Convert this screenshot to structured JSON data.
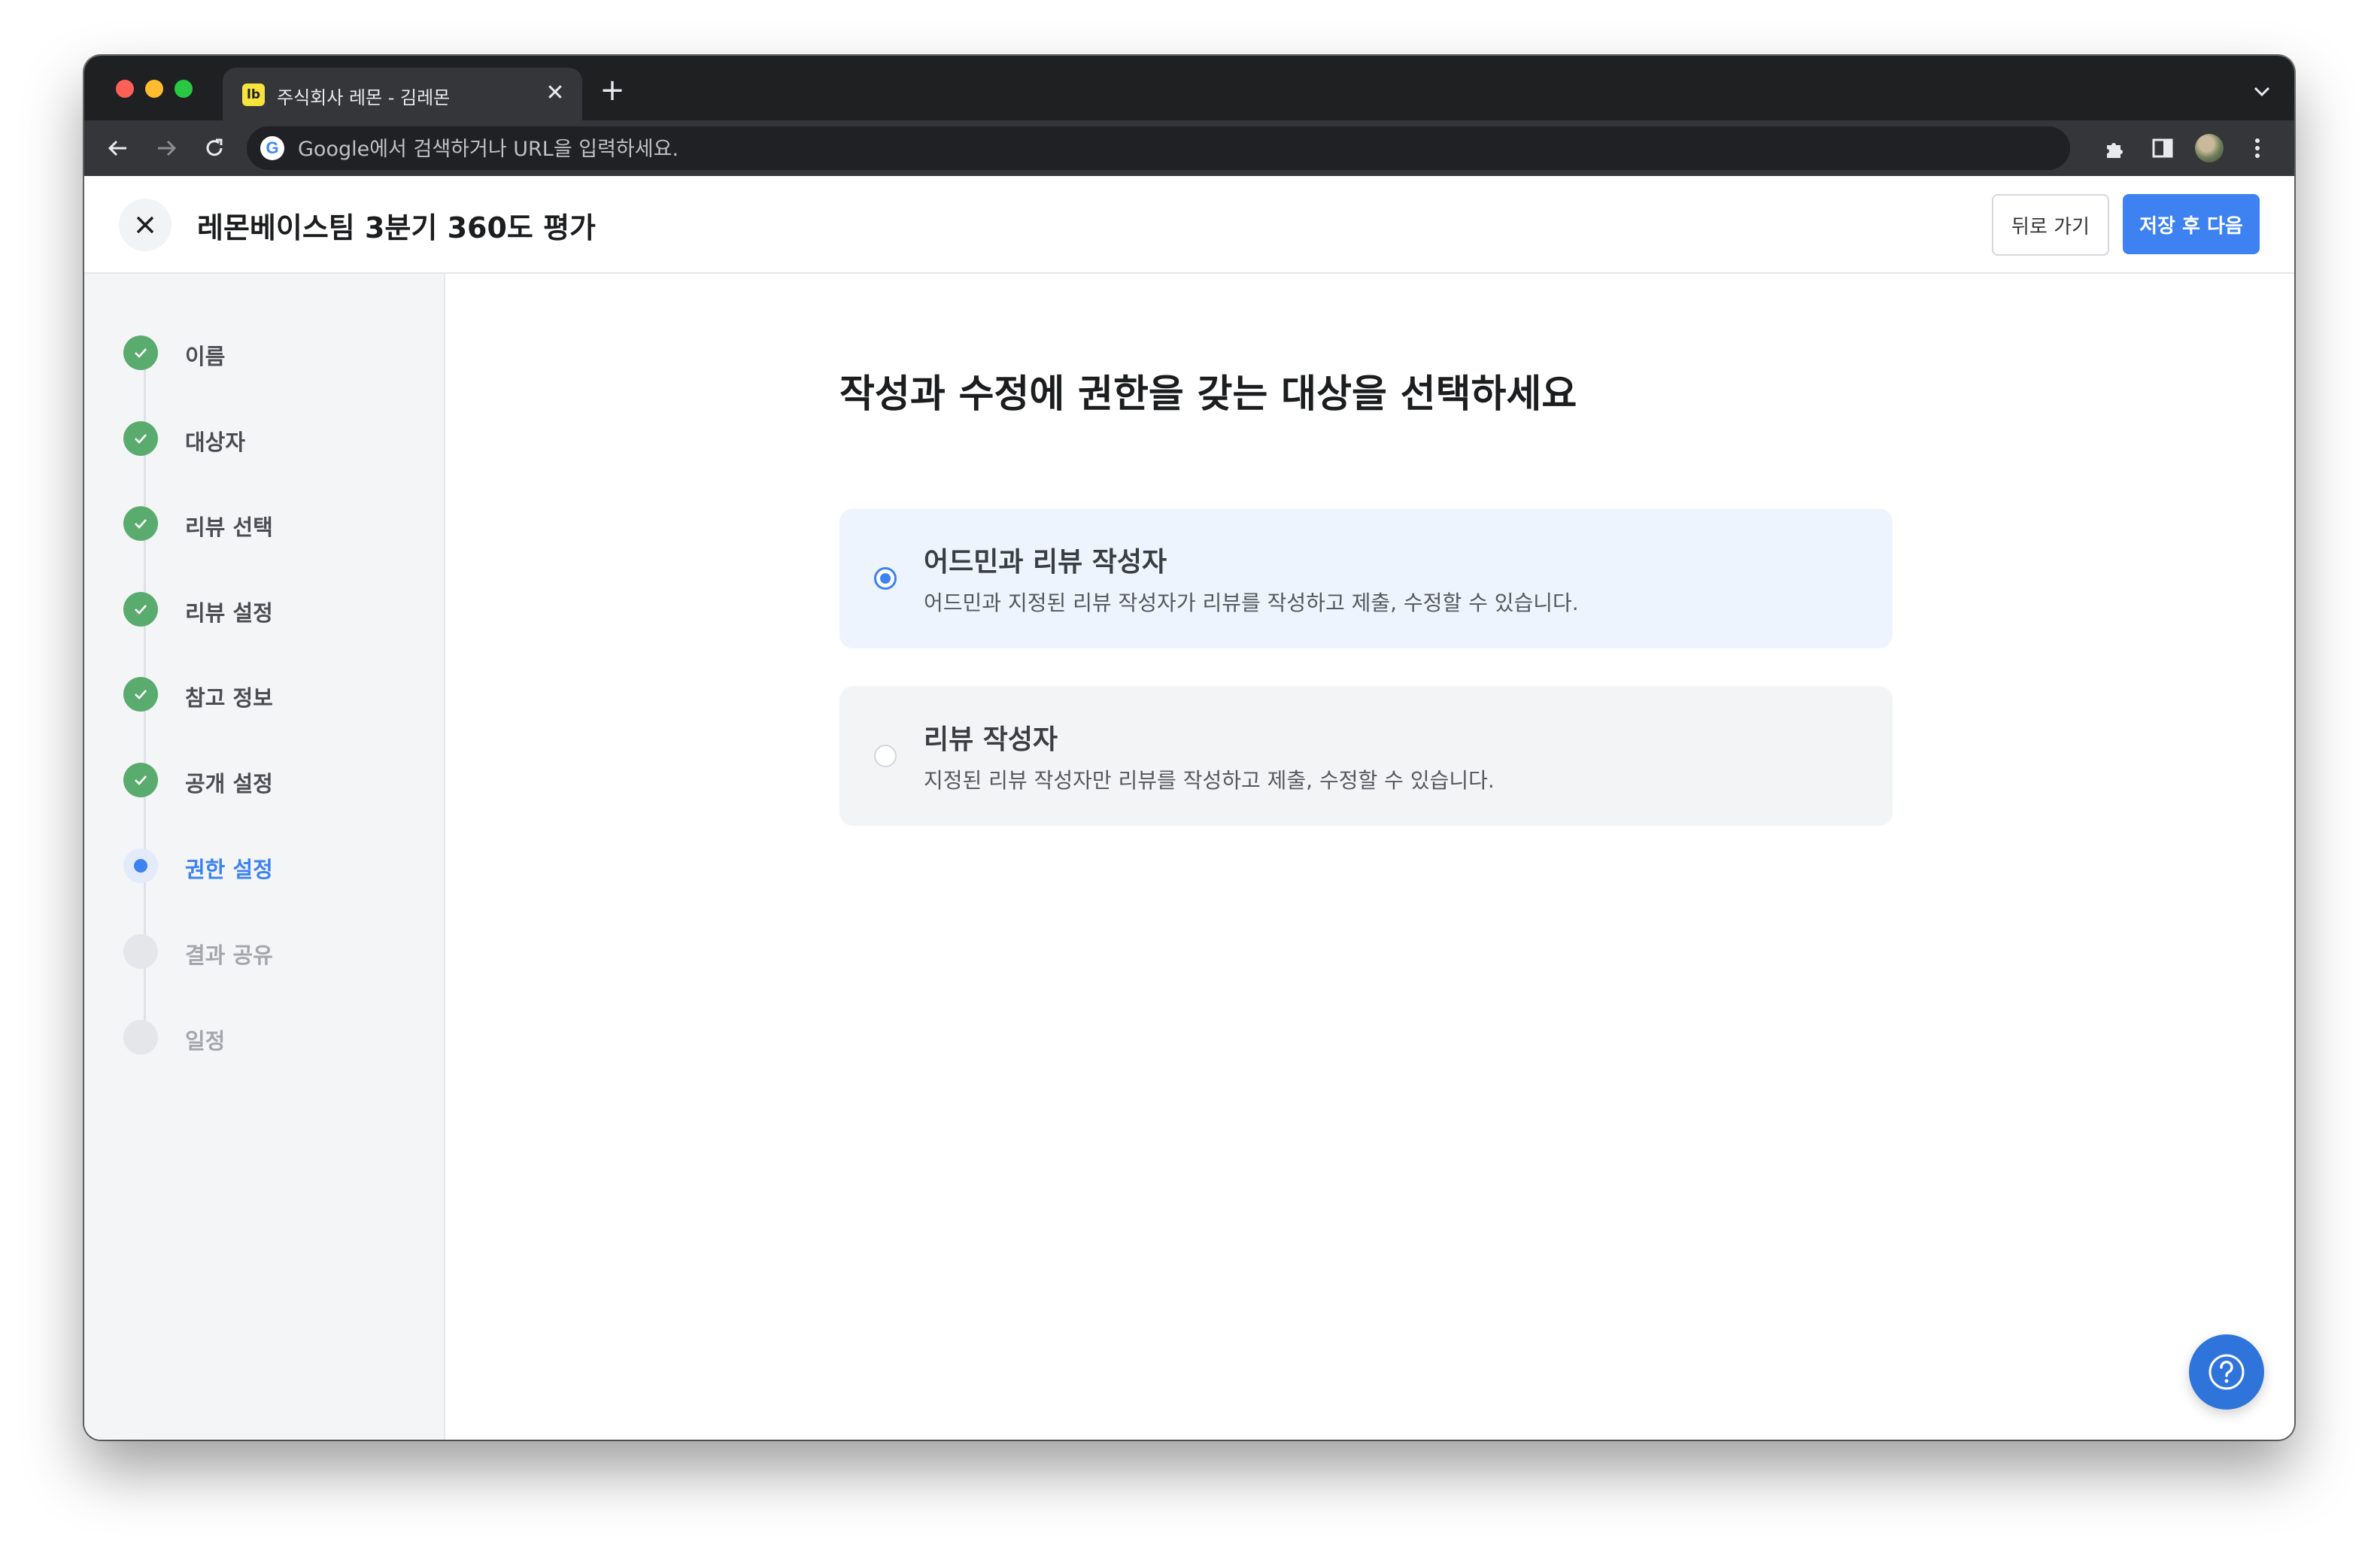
{
  "browser": {
    "tab_favicon": "lb",
    "tab_title": "주식회사 레몬 - 김레몬",
    "tab_close_glyph": "✕",
    "new_tab_glyph": "+",
    "address_placeholder": "Google에서 검색하거나 URL을 입력하세요.",
    "google_glyph": "G"
  },
  "header": {
    "title": "레몬베이스팀 3분기 360도 평가",
    "back_label": "뒤로 가기",
    "next_label": "저장 후 다음"
  },
  "steps": [
    {
      "label": "이름",
      "status": "done"
    },
    {
      "label": "대상자",
      "status": "done"
    },
    {
      "label": "리뷰 선택",
      "status": "done"
    },
    {
      "label": "리뷰 설정",
      "status": "done"
    },
    {
      "label": "참고 정보",
      "status": "done"
    },
    {
      "label": "공개 설정",
      "status": "done"
    },
    {
      "label": "권한 설정",
      "status": "current"
    },
    {
      "label": "결과 공유",
      "status": "todo"
    },
    {
      "label": "일정",
      "status": "todo"
    }
  ],
  "main": {
    "question": "작성과 수정에 권한을 갖는 대상을 선택하세요",
    "options": [
      {
        "title": "어드민과 리뷰 작성자",
        "description": "어드민과 지정된 리뷰 작성자가 리뷰를 작성하고 제출, 수정할 수 있습니다.",
        "selected": true
      },
      {
        "title": "리뷰 작성자",
        "description": "지정된 리뷰 작성자만 리뷰를 작성하고 제출, 수정할 수 있습니다.",
        "selected": false
      }
    ]
  },
  "colors": {
    "accent": "#3d82f0",
    "done": "#5aab6e",
    "selected_bg": "#edf4fd"
  }
}
